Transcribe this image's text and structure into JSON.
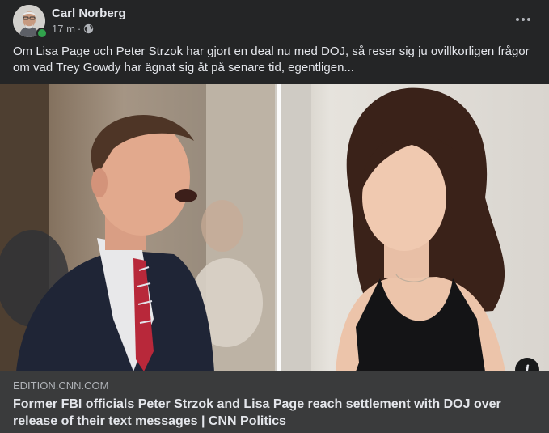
{
  "post": {
    "author": "Carl Norberg",
    "time": "17 m",
    "separator": "·",
    "privacy_icon": "globe-icon",
    "more_icon": "more-horizontal-icon",
    "text": "Om Lisa Page och Peter Strzok har gjort en deal nu med DOJ, så reser sig ju ovillkorligen frågor om vad Trey Gowdy har ägnat sig åt på senare tid, egentligen..."
  },
  "link": {
    "domain": "EDITION.CNN.COM",
    "headline": "Former FBI officials Peter Strzok and Lisa Page reach settlement with DOJ over release of their text messages | CNN Politics",
    "info_label": "i"
  },
  "colors": {
    "card_bg": "#242526",
    "link_info_bg": "#3a3b3c",
    "text_primary": "#e4e6eb",
    "text_secondary": "#b0b3b8",
    "online": "#31a24c"
  }
}
